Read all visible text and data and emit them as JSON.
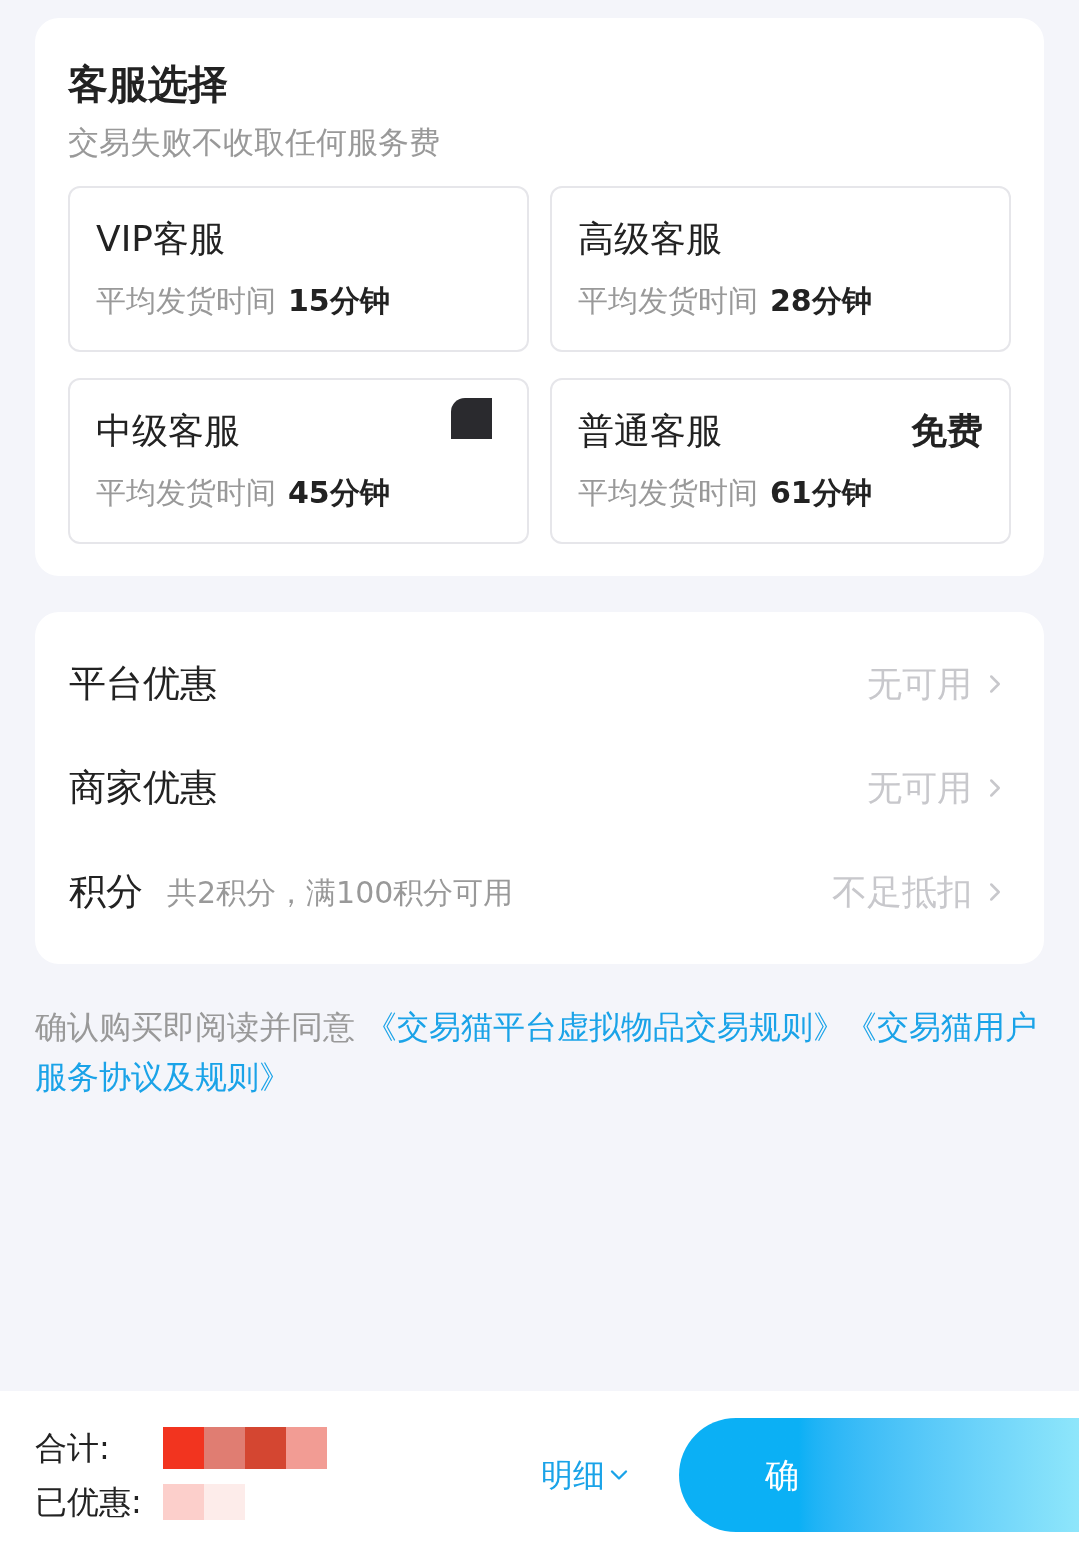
{
  "service": {
    "title": "客服选择",
    "subtitle": "交易失败不收取任何服务费",
    "options": [
      {
        "name": "VIP客服",
        "label": "平均发货时间",
        "time": "15分钟",
        "price_hidden": false
      },
      {
        "name": "高级客服",
        "label": "平均发货时间",
        "time": "28分钟",
        "price_hidden": false
      },
      {
        "name": "中级客服",
        "label": "平均发货时间",
        "time": "45分钟",
        "price_hidden": true
      },
      {
        "name": "普通客服",
        "label": "平均发货时间",
        "time": "61分钟",
        "price_hidden": false,
        "badge": "免费"
      }
    ]
  },
  "discounts": [
    {
      "label": "平台优惠",
      "value": "无可用"
    },
    {
      "label": "商家优惠",
      "value": "无可用"
    },
    {
      "label": "积分",
      "note": "共2积分，满100积分可用",
      "value": "不足抵扣"
    }
  ],
  "agreement": {
    "text": "确认购买即阅读并同意",
    "links": [
      "《交易猫平台虚拟物品交易规则》",
      "《交易猫用户服务协议及规则》"
    ]
  },
  "footer": {
    "total_label": "合计:",
    "discount_label": "已优惠:",
    "detail": "明细",
    "confirm": "确"
  }
}
